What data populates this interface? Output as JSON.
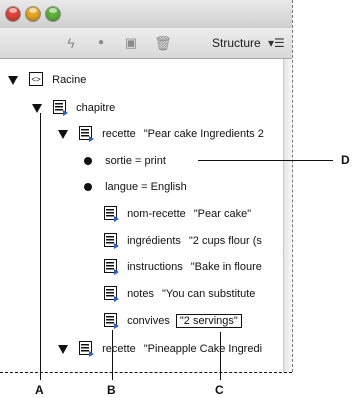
{
  "toolbar": {
    "title": "Structure",
    "menu_glyph": "▾☰",
    "icons": [
      "lightning-icon",
      "dot-icon",
      "box-icon",
      "trash-icon"
    ]
  },
  "tree": {
    "root": "Racine",
    "chapter": "chapitre",
    "recipe_1": {
      "tag": "recette",
      "value": "\"Pear cake Ingredients 2"
    },
    "attr_output": "sortie = print",
    "attr_lang": "langue = English",
    "name": {
      "tag": "nom-recette",
      "value": "\"Pear cake\""
    },
    "ingredients": {
      "tag": "ingrédients",
      "value": "\"2 cups flour (s"
    },
    "instructions": {
      "tag": "instructions",
      "value": "\"Bake in floure"
    },
    "notes": {
      "tag": "notes",
      "value": "\"You can substitute"
    },
    "servings": {
      "tag": "convives",
      "value": "\"2 servings\""
    },
    "recipe_2": {
      "tag": "recette",
      "value": "\"Pineapple Cake Ingredi"
    }
  },
  "callouts": {
    "a": "A",
    "b": "B",
    "c": "C",
    "d": "D"
  },
  "colors": {
    "element_icon_blue": "#2a5fd0",
    "window_chrome": "#dcdcdc"
  }
}
